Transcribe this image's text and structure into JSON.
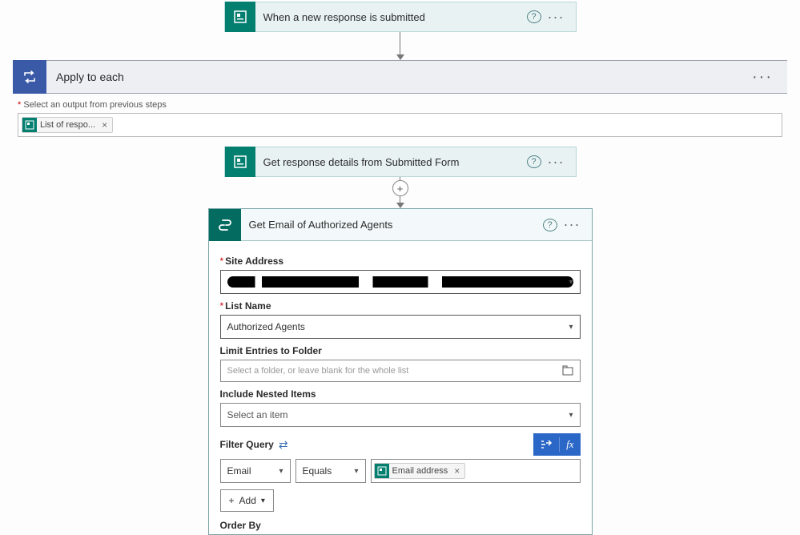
{
  "trigger": {
    "title": "When a new response is submitted"
  },
  "applyToEach": {
    "title": "Apply to each",
    "outputLabel": "Select an output from previous steps",
    "outputTokenLabel": "List of respo..."
  },
  "getDetails": {
    "title": "Get response details from Submitted Form"
  },
  "sharepoint": {
    "title": "Get Email of Authorized Agents",
    "fields": {
      "siteAddressLabel": "Site Address",
      "listNameLabel": "List Name",
      "listNameValue": "Authorized Agents",
      "limitLabel": "Limit Entries to Folder",
      "limitPlaceholder": "Select a folder, or leave blank for the whole list",
      "nestedLabel": "Include Nested Items",
      "nestedPlaceholder": "Select an item",
      "filterLabel": "Filter Query",
      "filterColumn": "Email",
      "filterOperator": "Equals",
      "filterTokenLabel": "Email address",
      "addBtn": "Add",
      "orderByLabel": "Order By"
    }
  },
  "glyphs": {
    "help": "?",
    "more": "···",
    "close": "×",
    "caret": "▾",
    "plus": "+",
    "fx": "fx",
    "swap": "⇄"
  }
}
